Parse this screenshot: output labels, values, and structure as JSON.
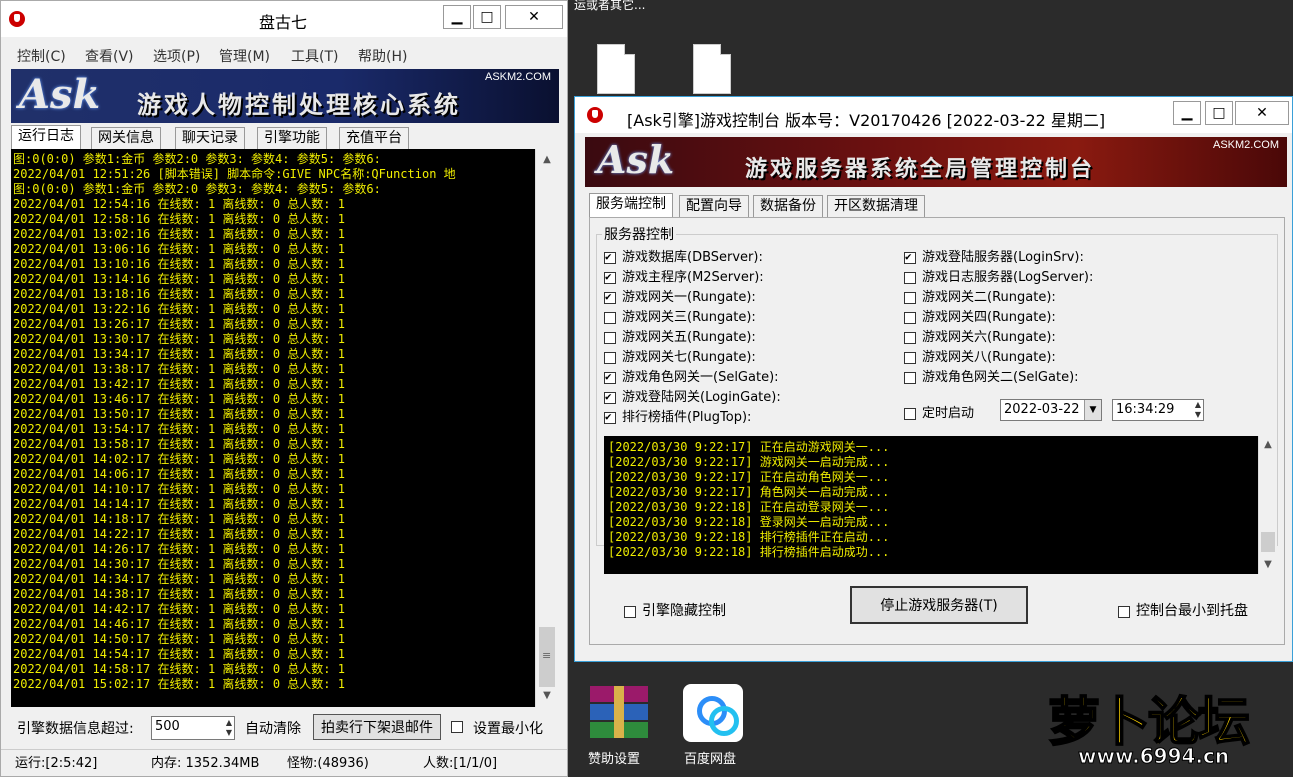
{
  "desktop": {
    "top_text_right": "运或者其它...",
    "icons": [
      {
        "label": "赞助设置"
      },
      {
        "label": "百度网盘"
      }
    ],
    "watermark_site": "www.6994.cn",
    "watermark_brand": "萝卜论坛"
  },
  "pangu": {
    "title": "盘古七",
    "menu": [
      "控制(C)",
      "查看(V)",
      "选项(P)",
      "管理(M)",
      "工具(T)",
      "帮助(H)"
    ],
    "banner_logo": "Ask",
    "banner_site": "ASKM2.COM",
    "banner_title": "游戏人物控制处理核心系统",
    "tabs": [
      "运行日志",
      "网关信息",
      "聊天记录",
      "引擎功能",
      "充值平台"
    ],
    "log_lines": [
      "图:0(0:0) 参数1:金币 参数2:0 参数3: 参数4: 参数5: 参数6:",
      "2022/04/01 12:51:26 [脚本错误] 脚本命令:GIVE NPC名称:QFunction 地",
      "图:0(0:0) 参数1:金币 参数2:0 参数3: 参数4: 参数5: 参数6:",
      "2022/04/01 12:54:16 在线数: 1 离线数: 0 总人数: 1",
      "2022/04/01 12:58:16 在线数: 1 离线数: 0 总人数: 1",
      "2022/04/01 13:02:16 在线数: 1 离线数: 0 总人数: 1",
      "2022/04/01 13:06:16 在线数: 1 离线数: 0 总人数: 1",
      "2022/04/01 13:10:16 在线数: 1 离线数: 0 总人数: 1",
      "2022/04/01 13:14:16 在线数: 1 离线数: 0 总人数: 1",
      "2022/04/01 13:18:16 在线数: 1 离线数: 0 总人数: 1",
      "2022/04/01 13:22:16 在线数: 1 离线数: 0 总人数: 1",
      "2022/04/01 13:26:17 在线数: 1 离线数: 0 总人数: 1",
      "2022/04/01 13:30:17 在线数: 1 离线数: 0 总人数: 1",
      "2022/04/01 13:34:17 在线数: 1 离线数: 0 总人数: 1",
      "2022/04/01 13:38:17 在线数: 1 离线数: 0 总人数: 1",
      "2022/04/01 13:42:17 在线数: 1 离线数: 0 总人数: 1",
      "2022/04/01 13:46:17 在线数: 1 离线数: 0 总人数: 1",
      "2022/04/01 13:50:17 在线数: 1 离线数: 0 总人数: 1",
      "2022/04/01 13:54:17 在线数: 1 离线数: 0 总人数: 1",
      "2022/04/01 13:58:17 在线数: 1 离线数: 0 总人数: 1",
      "2022/04/01 14:02:17 在线数: 1 离线数: 0 总人数: 1",
      "2022/04/01 14:06:17 在线数: 1 离线数: 0 总人数: 1",
      "2022/04/01 14:10:17 在线数: 1 离线数: 0 总人数: 1",
      "2022/04/01 14:14:17 在线数: 1 离线数: 0 总人数: 1",
      "2022/04/01 14:18:17 在线数: 1 离线数: 0 总人数: 1",
      "2022/04/01 14:22:17 在线数: 1 离线数: 0 总人数: 1",
      "2022/04/01 14:26:17 在线数: 1 离线数: 0 总人数: 1",
      "2022/04/01 14:30:17 在线数: 1 离线数: 0 总人数: 1",
      "2022/04/01 14:34:17 在线数: 1 离线数: 0 总人数: 1",
      "2022/04/01 14:38:17 在线数: 1 离线数: 0 总人数: 1",
      "2022/04/01 14:42:17 在线数: 1 离线数: 0 总人数: 1",
      "2022/04/01 14:46:17 在线数: 1 离线数: 0 总人数: 1",
      "2022/04/01 14:50:17 在线数: 1 离线数: 0 总人数: 1",
      "2022/04/01 14:54:17 在线数: 1 离线数: 0 总人数: 1",
      "2022/04/01 14:58:17 在线数: 1 离线数: 0 总人数: 1",
      "2022/04/01 15:02:17 在线数: 1 离线数: 0 总人数: 1"
    ],
    "bottom": {
      "threshold_label": "引擎数据信息超过:",
      "threshold_value": "500",
      "auto_clear_label": "自动清除",
      "auction_button": "拍卖行下架退邮件",
      "minimize_label": "设置最小化"
    },
    "status": {
      "run": "运行:[2:5:42]",
      "memory": "内存: 1352.34MB",
      "monsters": "怪物:(48936)",
      "players": "人数:[1/1/0]"
    }
  },
  "console": {
    "title": "[Ask引擎]游戏控制台 版本号：V20170426 [2022-03-22 星期二]",
    "banner_logo": "Ask",
    "banner_site": "ASKM2.COM",
    "banner_title": "游戏服务器系统全局管理控制台",
    "tabs": [
      "服务端控制",
      "配置向导",
      "数据备份",
      "开区数据清理"
    ],
    "group_label": "服务器控制",
    "left_items": [
      {
        "label": "游戏数据库(DBServer):",
        "checked": true
      },
      {
        "label": "游戏主程序(M2Server):",
        "checked": true
      },
      {
        "label": "游戏网关一(Rungate):",
        "checked": true
      },
      {
        "label": "游戏网关三(Rungate):",
        "checked": false
      },
      {
        "label": "游戏网关五(Rungate):",
        "checked": false
      },
      {
        "label": "游戏网关七(Rungate):",
        "checked": false
      },
      {
        "label": "游戏角色网关一(SelGate):",
        "checked": true
      },
      {
        "label": "游戏登陆网关(LoginGate):",
        "checked": true
      },
      {
        "label": "排行榜插件(PlugTop):",
        "checked": true
      }
    ],
    "right_items": [
      {
        "label": "游戏登陆服务器(LoginSrv):",
        "checked": true
      },
      {
        "label": "游戏日志服务器(LogServer):",
        "checked": false
      },
      {
        "label": "游戏网关二(Rungate):",
        "checked": false
      },
      {
        "label": "游戏网关四(Rungate):",
        "checked": false
      },
      {
        "label": "游戏网关六(Rungate):",
        "checked": false
      },
      {
        "label": "游戏网关八(Rungate):",
        "checked": false
      },
      {
        "label": "游戏角色网关二(SelGate):",
        "checked": false
      }
    ],
    "timer": {
      "label": "定时启动",
      "date": "2022-03-22",
      "time": "16:34:29"
    },
    "log_lines": [
      "[2022/03/30 9:22:17] 正在启动游戏网关一...",
      "[2022/03/30 9:22:17] 游戏网关一启动完成...",
      "[2022/03/30 9:22:17] 正在启动角色网关一...",
      "[2022/03/30 9:22:17] 角色网关一启动完成...",
      "[2022/03/30 9:22:18] 正在启动登录网关一...",
      "[2022/03/30 9:22:18] 登录网关一启动完成...",
      "[2022/03/30 9:22:18] 排行榜插件正在启动...",
      "[2022/03/30 9:22:18] 排行榜插件启动成功..."
    ],
    "hide_engine_label": "引擎隐藏控制",
    "stop_button": "停止游戏服务器(T)",
    "tray_label": "控制台最小到托盘"
  }
}
